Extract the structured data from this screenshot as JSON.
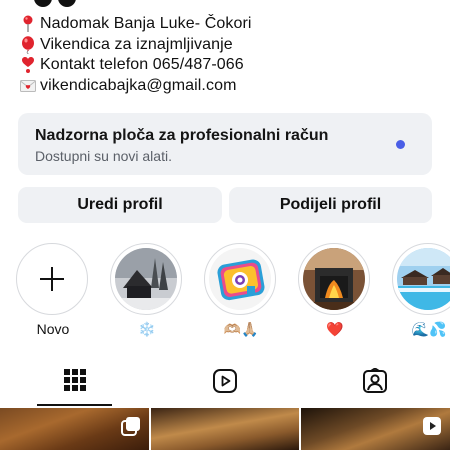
{
  "bio": {
    "lines": [
      {
        "icon": "pin-icon",
        "text": "Nadomak Banja Luke- Čokori"
      },
      {
        "icon": "balloon-icon",
        "text": "Vikendica za iznajmljivanje"
      },
      {
        "icon": "heart-exclamation-icon",
        "text": "Kontakt telefon 065/487-066"
      },
      {
        "icon": "love-letter-icon",
        "text": " vikendicabajka@gmail.com"
      }
    ]
  },
  "pro_dashboard": {
    "title": "Nadzorna ploča za profesionalni račun",
    "subtitle": "Dostupni su novi alati."
  },
  "actions": {
    "edit_label": "Uredi profil",
    "share_label": "Podijeli profil"
  },
  "highlights": [
    {
      "label": "Novo",
      "type": "new"
    },
    {
      "label": "❄️",
      "type": "winter-cabin"
    },
    {
      "label": "🫶🏼🙏🏼",
      "type": "instagram-logo"
    },
    {
      "label": "❤️",
      "type": "fireplace"
    },
    {
      "label": "🌊💦",
      "type": "pool"
    }
  ],
  "tabs": [
    {
      "name": "grid-icon",
      "active": true
    },
    {
      "name": "reels-icon",
      "active": false
    },
    {
      "name": "tagged-icon",
      "active": false
    }
  ],
  "colors": {
    "accent_dot": "#4a5ee6",
    "card_bg": "#eff1f4"
  }
}
